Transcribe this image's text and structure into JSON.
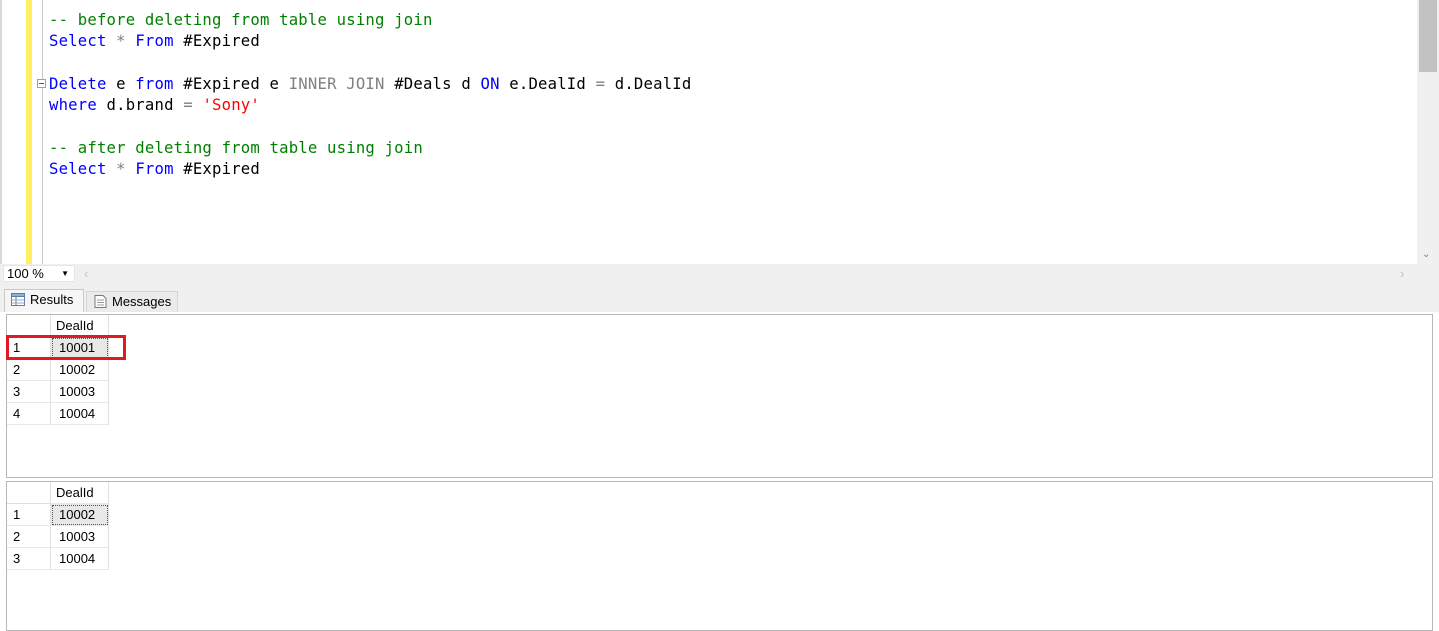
{
  "editor": {
    "lines": [
      [
        {
          "cls": "c",
          "text": "-- before deleting from table using join"
        }
      ],
      [
        {
          "cls": "k",
          "text": "Select"
        },
        {
          "cls": "t",
          "text": " "
        },
        {
          "cls": "g",
          "text": "*"
        },
        {
          "cls": "t",
          "text": " "
        },
        {
          "cls": "k",
          "text": "From"
        },
        {
          "cls": "t",
          "text": " #Expired"
        }
      ],
      [],
      [
        {
          "cls": "k",
          "text": "Delete"
        },
        {
          "cls": "t",
          "text": " e "
        },
        {
          "cls": "k",
          "text": "from"
        },
        {
          "cls": "t",
          "text": " #Expired e "
        },
        {
          "cls": "g",
          "text": "INNER JOIN"
        },
        {
          "cls": "t",
          "text": " #Deals d "
        },
        {
          "cls": "k",
          "text": "ON"
        },
        {
          "cls": "t",
          "text": " e.DealId "
        },
        {
          "cls": "g",
          "text": "="
        },
        {
          "cls": "t",
          "text": " d.DealId"
        }
      ],
      [
        {
          "cls": "k",
          "text": "where"
        },
        {
          "cls": "t",
          "text": " d.brand "
        },
        {
          "cls": "g",
          "text": "="
        },
        {
          "cls": "t",
          "text": " "
        },
        {
          "cls": "s",
          "text": "'Sony'"
        }
      ],
      [],
      [
        {
          "cls": "c",
          "text": "-- after deleting from table using join"
        }
      ],
      [
        {
          "cls": "k",
          "text": "Select"
        },
        {
          "cls": "t",
          "text": " "
        },
        {
          "cls": "g",
          "text": "*"
        },
        {
          "cls": "t",
          "text": " "
        },
        {
          "cls": "k",
          "text": "From"
        },
        {
          "cls": "t",
          "text": " #Expired"
        }
      ]
    ]
  },
  "zoom": {
    "value": "100 %"
  },
  "tabs": {
    "results": "Results",
    "messages": "Messages"
  },
  "results": [
    {
      "column": "DealId",
      "rows": [
        {
          "n": "1",
          "v": "10001"
        },
        {
          "n": "2",
          "v": "10002"
        },
        {
          "n": "3",
          "v": "10003"
        },
        {
          "n": "4",
          "v": "10004"
        }
      ]
    },
    {
      "column": "DealId",
      "rows": [
        {
          "n": "1",
          "v": "10002"
        },
        {
          "n": "2",
          "v": "10003"
        },
        {
          "n": "3",
          "v": "10004"
        }
      ]
    }
  ],
  "colors": {
    "highlight": "#e01a22",
    "keyword": "#0000ff",
    "comment": "#008000",
    "string": "#ff0000",
    "operator": "#808080"
  },
  "icons": [
    "grid-icon",
    "messages-icon",
    "collapse-icon",
    "chevron-down-icon",
    "scroll-left-icon",
    "scroll-right-icon"
  ]
}
